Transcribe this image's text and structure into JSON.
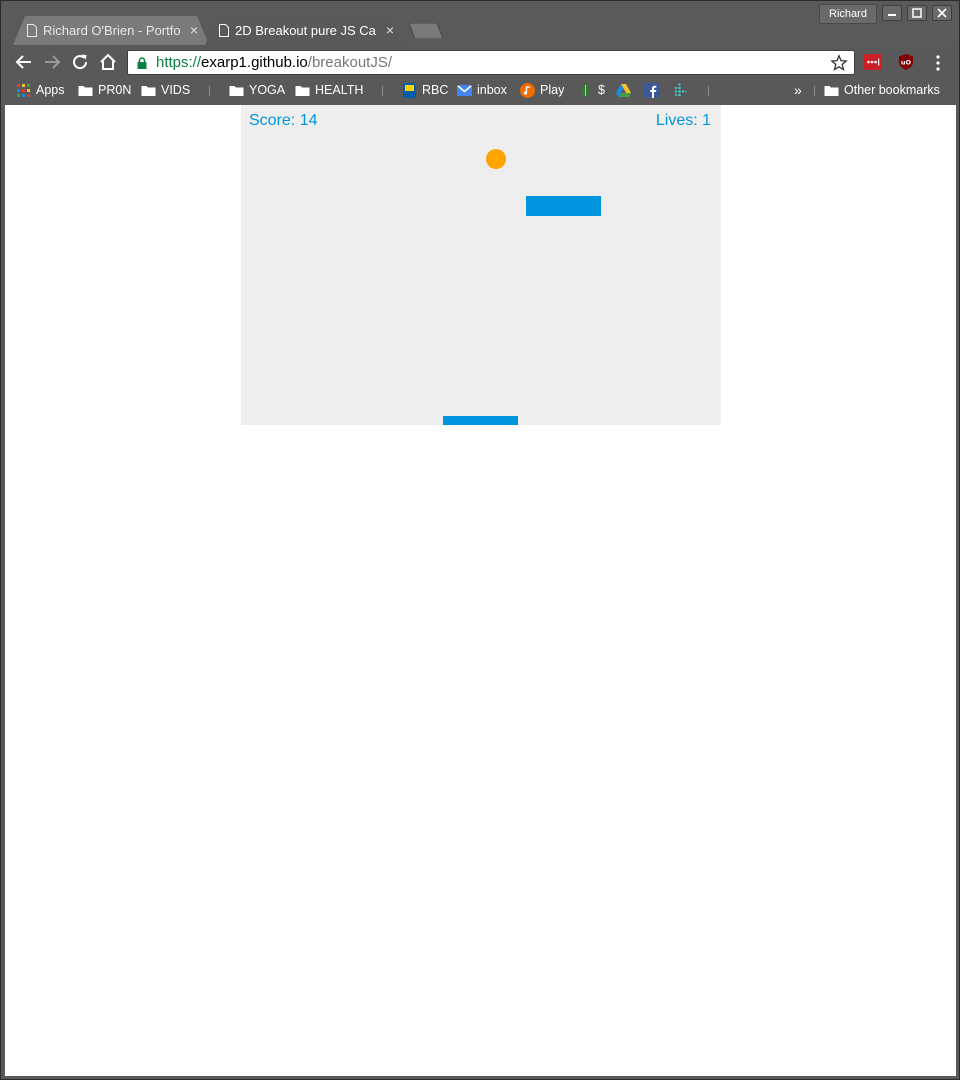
{
  "browser": {
    "profile_name": "Richard",
    "tabs": [
      {
        "title": "Richard O'Brien - Portfo",
        "active": false
      },
      {
        "title": "2D Breakout pure JS Ca",
        "active": true
      }
    ],
    "tab_close_glyph": "×",
    "url": {
      "scheme": "https://",
      "host": "exarp1.github.io",
      "path": "/breakoutJS/"
    },
    "bookmarks": {
      "apps": "Apps",
      "folder1": "PR0N",
      "folder2": "VIDS",
      "folder3": "YOGA",
      "folder4": "HEALTH",
      "rbc": "RBC",
      "inbox": "inbox",
      "play": "Play",
      "dollar": "$",
      "overflow": "»",
      "other": "Other bookmarks"
    }
  },
  "game": {
    "score_label": "Score: 14",
    "lives_label": "Lives: 1",
    "colors": {
      "background": "#eeeeee",
      "accent": "#0095DD",
      "ball": "#ffa500"
    }
  }
}
